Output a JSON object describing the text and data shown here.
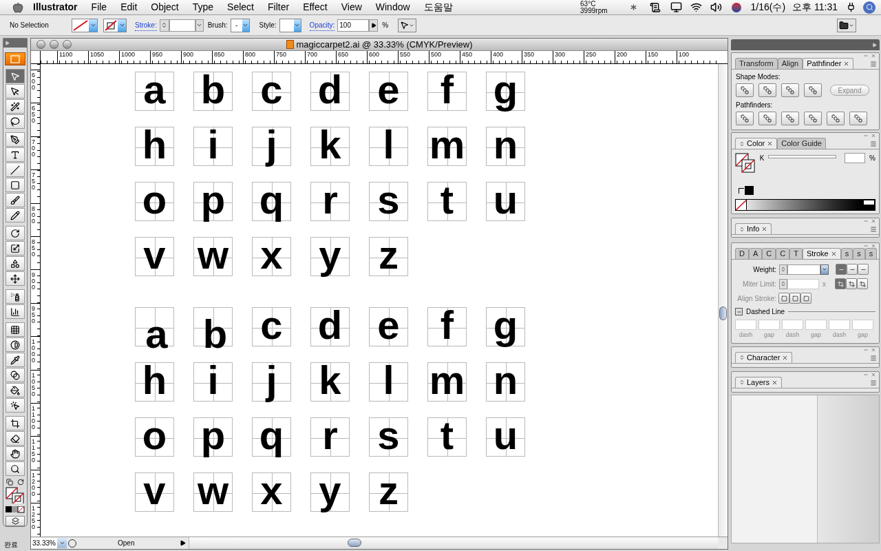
{
  "menu_bar": {
    "app_name": "Illustrator",
    "menus": [
      "File",
      "Edit",
      "Object",
      "Type",
      "Select",
      "Filter",
      "Effect",
      "View",
      "Window",
      "도움말"
    ],
    "temperature": "63°C",
    "fan_speed": "3999rpm",
    "date": "1/16(수)",
    "time": "오후 11:31"
  },
  "control_bar": {
    "selection_status": "No Selection",
    "stroke_label": "Stroke:",
    "brush_label": "Brush:",
    "brush_value": "-",
    "style_label": "Style:",
    "opacity_label": "Opacity:",
    "opacity_value": "100",
    "opacity_unit": "%"
  },
  "tools": [
    {
      "selected": true
    },
    {
      "selected": false
    },
    {
      "selected": false
    },
    {
      "selected": false
    },
    {
      "selected": false
    },
    {
      "selected": false
    },
    {
      "selected": false
    },
    {
      "selected": false
    },
    {
      "selected": false
    },
    {
      "selected": false
    },
    {
      "selected": false
    },
    {
      "selected": false
    },
    {
      "selected": false
    },
    {
      "selected": false
    },
    {
      "selected": false
    },
    {
      "selected": false
    },
    {
      "selected": false
    },
    {
      "selected": false
    },
    {
      "selected": false
    },
    {
      "selected": false
    },
    {
      "selected": false
    },
    {
      "selected": false
    },
    {
      "selected": false
    },
    {
      "selected": false
    },
    {
      "selected": false
    },
    {
      "selected": false
    }
  ],
  "document": {
    "title": "magiccarpet2.ai @ 33.33% (CMYK/Preview)",
    "ruler_h": [
      "1100",
      "1050",
      "1000",
      "950",
      "900",
      "850",
      "800",
      "750",
      "700",
      "650",
      "600",
      "550",
      "500",
      "450",
      "400",
      "350",
      "300",
      "250",
      "200",
      "150",
      "100"
    ],
    "ruler_v": [
      "600",
      "650",
      "700",
      "750",
      "800",
      "850",
      "900",
      "950",
      "1000",
      "1050",
      "1100",
      "1150",
      "1200",
      "1250"
    ],
    "grids": [
      {
        "letters": [
          {
            "char": "a",
            "shifted": false
          },
          {
            "char": "b",
            "shifted": false
          },
          {
            "char": "c",
            "shifted": false
          },
          {
            "char": "d",
            "shifted": false
          },
          {
            "char": "e",
            "shifted": false
          },
          {
            "char": "f",
            "shifted": false
          },
          {
            "char": "g",
            "shifted": false
          },
          {
            "char": "h",
            "shifted": false
          },
          {
            "char": "i",
            "shifted": false
          },
          {
            "char": "j",
            "shifted": false
          },
          {
            "char": "k",
            "shifted": false
          },
          {
            "char": "l",
            "shifted": false
          },
          {
            "char": "m",
            "shifted": false
          },
          {
            "char": "n",
            "shifted": false
          },
          {
            "char": "o",
            "shifted": false
          },
          {
            "char": "p",
            "shifted": false
          },
          {
            "char": "q",
            "shifted": false
          },
          {
            "char": "r",
            "shifted": false
          },
          {
            "char": "s",
            "shifted": false
          },
          {
            "char": "t",
            "shifted": false
          },
          {
            "char": "u",
            "shifted": false
          },
          {
            "char": "v",
            "shifted": false
          },
          {
            "char": "w",
            "shifted": false
          },
          {
            "char": "x",
            "shifted": false
          },
          {
            "char": "y",
            "shifted": false
          },
          {
            "char": "z",
            "shifted": false
          }
        ]
      },
      {
        "letters": [
          {
            "char": "a",
            "shifted": true
          },
          {
            "char": "b",
            "shifted": true
          },
          {
            "char": "c",
            "shifted": false
          },
          {
            "char": "d",
            "shifted": false
          },
          {
            "char": "e",
            "shifted": false
          },
          {
            "char": "f",
            "shifted": false
          },
          {
            "char": "g",
            "shifted": false
          },
          {
            "char": "h",
            "shifted": false
          },
          {
            "char": "i",
            "shifted": false
          },
          {
            "char": "j",
            "shifted": false
          },
          {
            "char": "k",
            "shifted": false
          },
          {
            "char": "l",
            "shifted": false
          },
          {
            "char": "m",
            "shifted": false
          },
          {
            "char": "n",
            "shifted": false
          },
          {
            "char": "o",
            "shifted": false
          },
          {
            "char": "p",
            "shifted": false
          },
          {
            "char": "q",
            "shifted": false
          },
          {
            "char": "r",
            "shifted": false
          },
          {
            "char": "s",
            "shifted": false
          },
          {
            "char": "t",
            "shifted": false
          },
          {
            "char": "u",
            "shifted": false
          },
          {
            "char": "v",
            "shifted": false
          },
          {
            "char": "w",
            "shifted": false
          },
          {
            "char": "x",
            "shifted": false
          },
          {
            "char": "y",
            "shifted": false
          },
          {
            "char": "z",
            "shifted": false
          }
        ]
      }
    ],
    "zoom": "33.33%",
    "status": "Open"
  },
  "panels": {
    "pathfinder": {
      "tabs": [
        {
          "label": "Transform",
          "selected": false,
          "closable": false
        },
        {
          "label": "Align",
          "selected": false,
          "closable": false
        },
        {
          "label": "Pathfinder",
          "selected": true,
          "closable": true
        }
      ],
      "shape_modes_label": "Shape Modes:",
      "expand_label": "Expand",
      "expand_disabled": true,
      "pathfinders_label": "Pathfinders:"
    },
    "color": {
      "tabs": [
        {
          "label": "Color",
          "selected": true,
          "closable": true
        },
        {
          "label": "Color Guide",
          "selected": false,
          "closable": false
        }
      ],
      "channel": "K",
      "unit": "%"
    },
    "info": {
      "tabs": [
        {
          "label": "Info",
          "selected": true,
          "closable": true
        }
      ]
    },
    "stroke": {
      "tabs": [
        {
          "label": "D",
          "selected": false,
          "closable": false
        },
        {
          "label": "A",
          "selected": false,
          "closable": false
        },
        {
          "label": "C",
          "selected": false,
          "closable": false
        },
        {
          "label": "C",
          "selected": false,
          "closable": false
        },
        {
          "label": "T",
          "selected": false,
          "closable": false
        },
        {
          "label": "Stroke",
          "selected": true,
          "closable": true
        },
        {
          "label": "s",
          "selected": false,
          "closable": false
        },
        {
          "label": "s",
          "selected": false,
          "closable": false
        },
        {
          "label": "s",
          "selected": false,
          "closable": false
        }
      ],
      "weight_label": "Weight:",
      "miter_label": "Miter Limit:",
      "miter_unit": "x",
      "miter_disabled": true,
      "align_label": "Align Stroke:",
      "align_disabled": true,
      "dashed_label": "Dashed Line",
      "dashed_expanded": true,
      "caps": [
        {
          "selected": true
        },
        {
          "selected": false
        },
        {
          "selected": false
        }
      ],
      "joins": [
        {
          "selected": true
        },
        {
          "selected": false
        },
        {
          "selected": false
        }
      ],
      "dash_fields": [
        {
          "label": "dash"
        },
        {
          "label": "gap"
        },
        {
          "label": "dash"
        },
        {
          "label": "gap"
        },
        {
          "label": "dash"
        },
        {
          "label": "gap"
        }
      ]
    },
    "character": {
      "tabs": [
        {
          "label": "Character",
          "selected": true,
          "closable": true
        }
      ]
    },
    "layers": {
      "tabs": [
        {
          "label": "Layers",
          "selected": true,
          "closable": true
        }
      ]
    }
  },
  "status_left": "완료"
}
